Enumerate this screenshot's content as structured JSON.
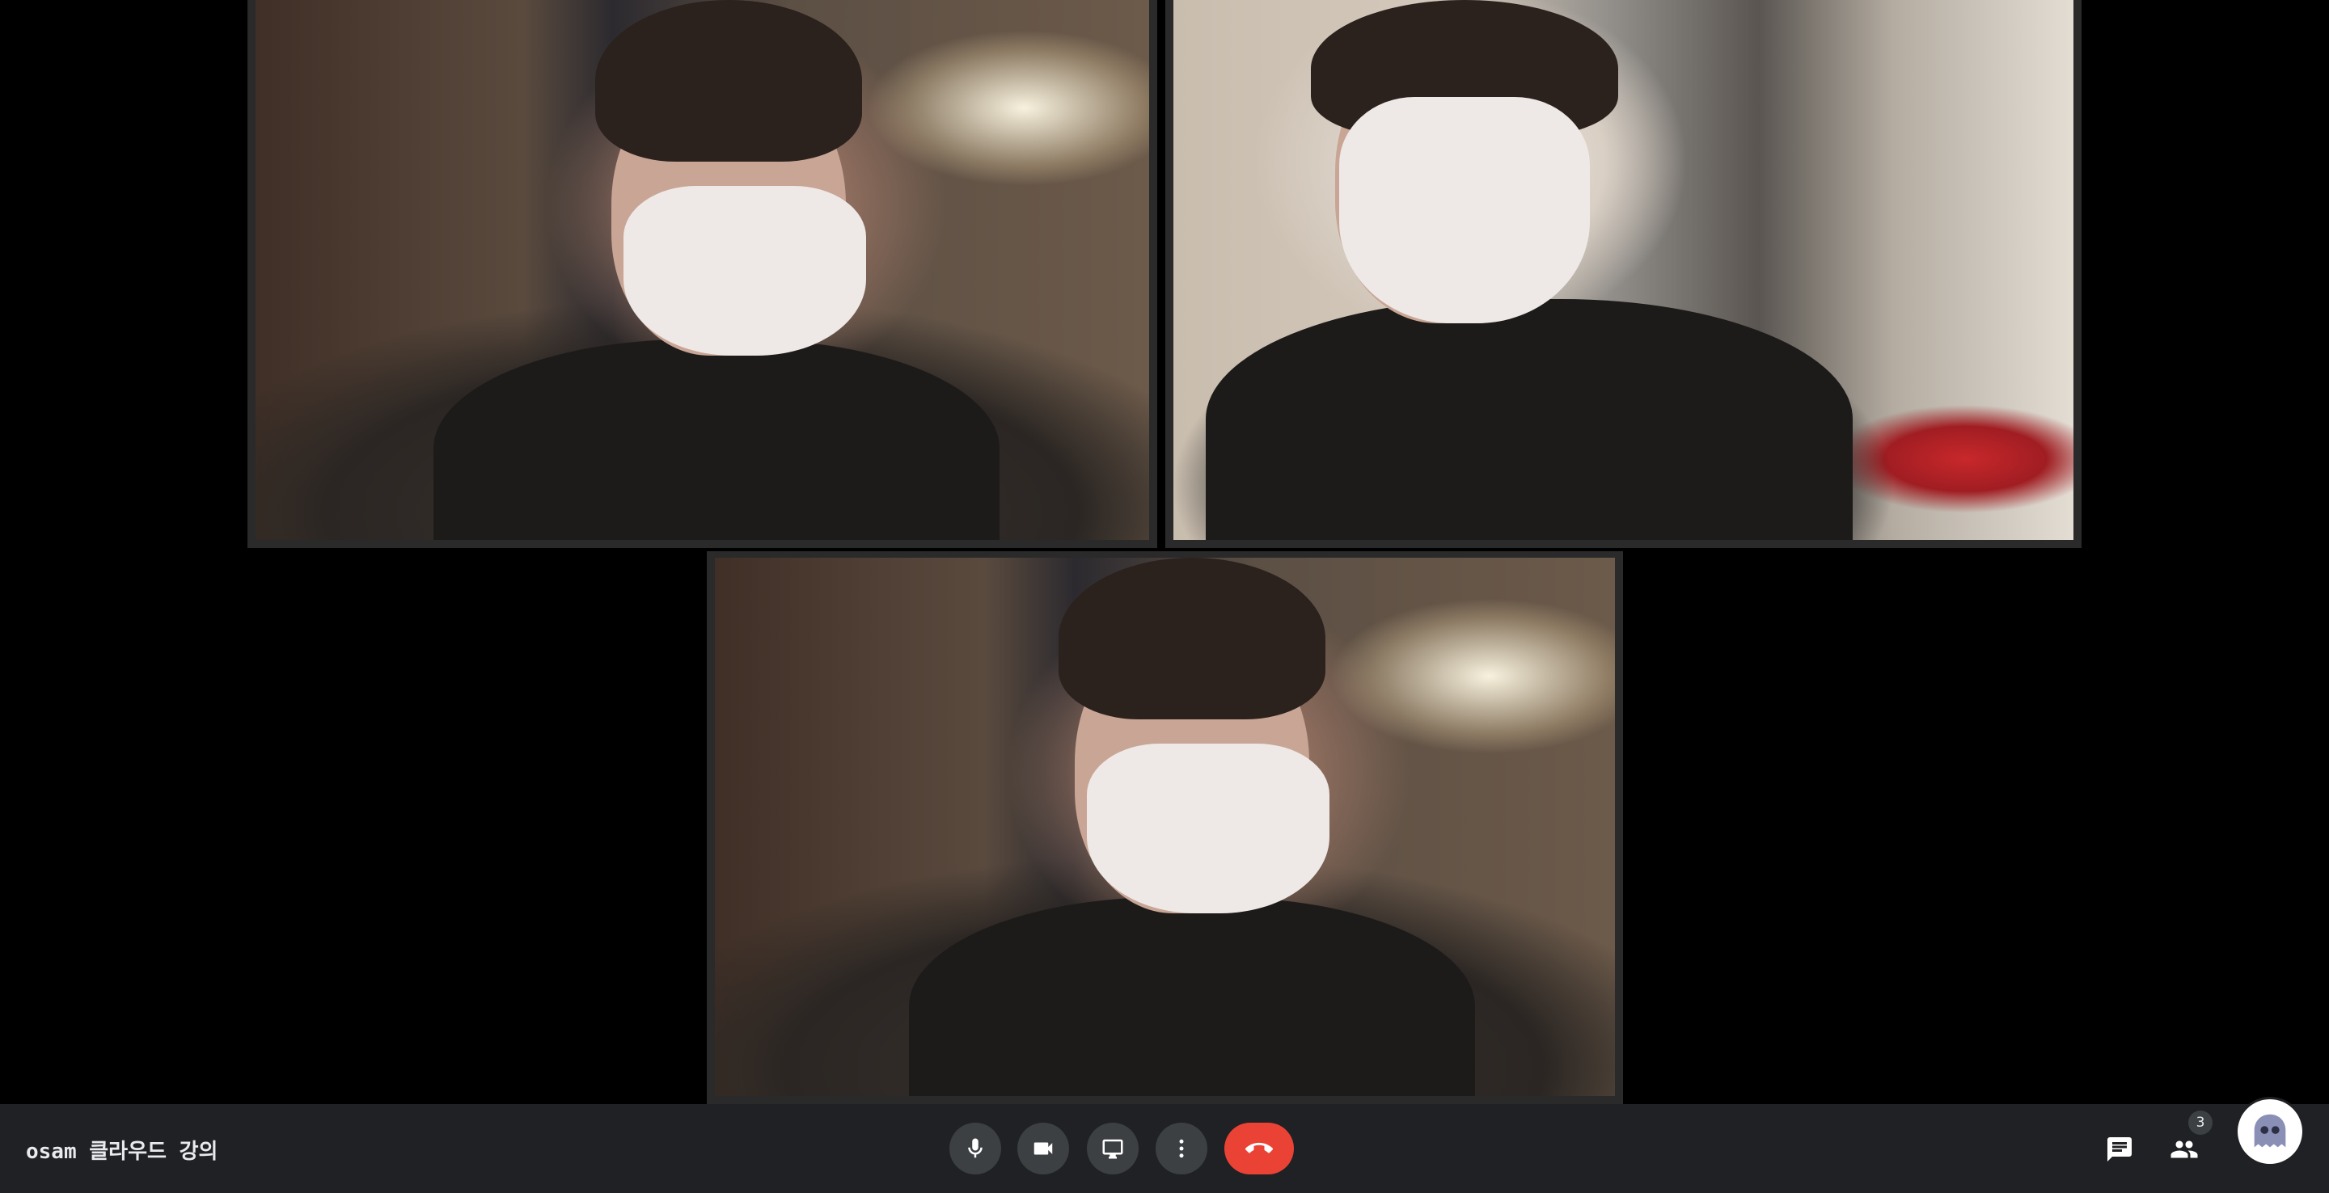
{
  "meeting": {
    "title": "osam 클라우드 강의"
  },
  "participants": {
    "count": "3"
  },
  "controls": {
    "mic": "microphone-icon",
    "camera": "video-camera-icon",
    "present": "present-screen-icon",
    "more": "more-options-icon",
    "hangup": "hang-up-icon",
    "chat": "chat-icon",
    "people": "people-icon"
  },
  "colors": {
    "hangup": "#ea4335",
    "control_bg": "#3c4043",
    "bar_bg": "#202124"
  }
}
